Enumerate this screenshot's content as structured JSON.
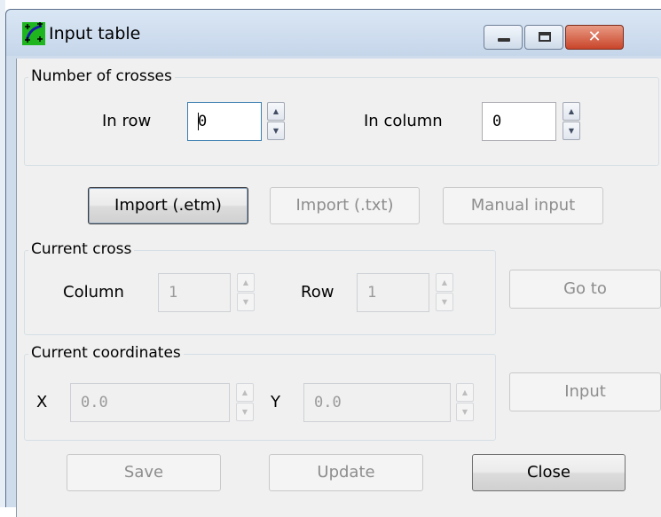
{
  "window": {
    "title": "Input table",
    "minimize_label": "",
    "maximize_label": "",
    "close_glyph": "✕"
  },
  "crosses_group": {
    "title": "Number of crosses",
    "in_row_label": "In row",
    "in_row_value": "0",
    "in_column_label": "In column",
    "in_column_value": "0"
  },
  "import_buttons": {
    "import_etm": "Import (.etm)",
    "import_txt": "Import (.txt)",
    "manual_input": "Manual input"
  },
  "current_cross": {
    "title": "Current cross",
    "column_label": "Column",
    "column_value": "1",
    "row_label": "Row",
    "row_value": "1",
    "goto_label": "Go to"
  },
  "current_coordinates": {
    "title": "Current coordinates",
    "x_label": "X",
    "x_value": "0.0",
    "y_label": "Y",
    "y_value": "0.0",
    "input_label": "Input"
  },
  "footer": {
    "save_label": "Save",
    "update_label": "Update",
    "close_label": "Close"
  },
  "icons": {
    "spin_up": "▲",
    "spin_down": "▼",
    "app_icon": "grid-cross-icon"
  },
  "colors": {
    "titlebar": "#cfdcec",
    "client": "#f0f0f0",
    "close_button": "#c9452a",
    "focus_border": "#3c7fb1"
  }
}
